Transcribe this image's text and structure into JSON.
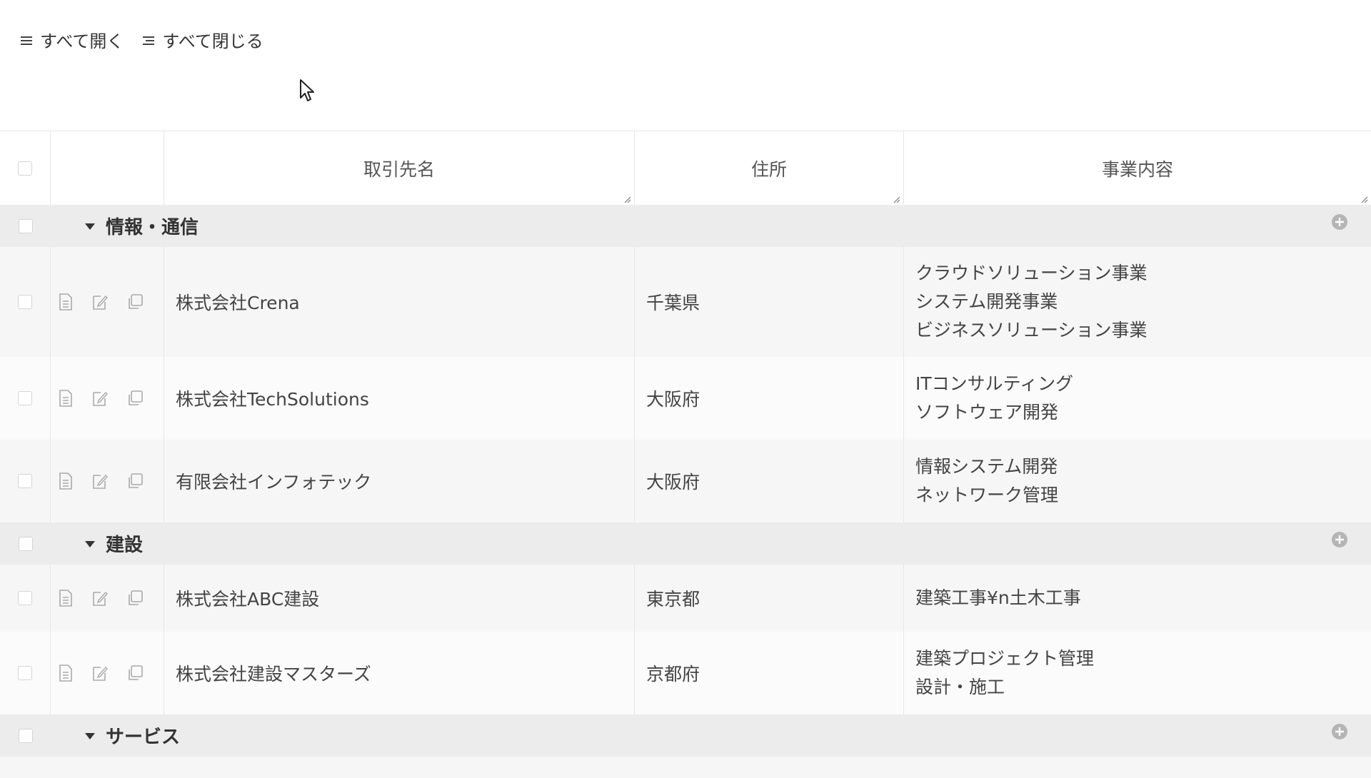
{
  "toolbar": {
    "expand_all": "すべて開く",
    "collapse_all": "すべて閉じる"
  },
  "columns": {
    "name": "取引先名",
    "address": "住所",
    "business": "事業内容"
  },
  "groups": [
    {
      "label": "情報・通信",
      "rows": [
        {
          "name": "株式会社Crena",
          "address": "千葉県",
          "business": [
            "クラウドソリューション事業",
            "システム開発事業",
            "ビジネスソリューション事業"
          ]
        },
        {
          "name": "株式会社TechSolutions",
          "address": "大阪府",
          "business": [
            "ITコンサルティング",
            "ソフトウェア開発"
          ]
        },
        {
          "name": "有限会社インフォテック",
          "address": "大阪府",
          "business": [
            "情報システム開発",
            "ネットワーク管理"
          ]
        }
      ]
    },
    {
      "label": "建設",
      "rows": [
        {
          "name": "株式会社ABC建設",
          "address": "東京都",
          "business": [
            "建築工事¥n土木工事"
          ]
        },
        {
          "name": "株式会社建設マスターズ",
          "address": "京都府",
          "business": [
            "建築プロジェクト管理",
            "設計・施工"
          ]
        }
      ]
    },
    {
      "label": "サービス",
      "rows": []
    }
  ],
  "icons": {
    "expand": "list-expand-icon",
    "collapse": "list-collapse-icon",
    "view": "document-icon",
    "edit": "edit-icon",
    "copy": "copy-icon",
    "group_toggle": "caret-down-icon",
    "group_add": "plus-circle-icon"
  }
}
